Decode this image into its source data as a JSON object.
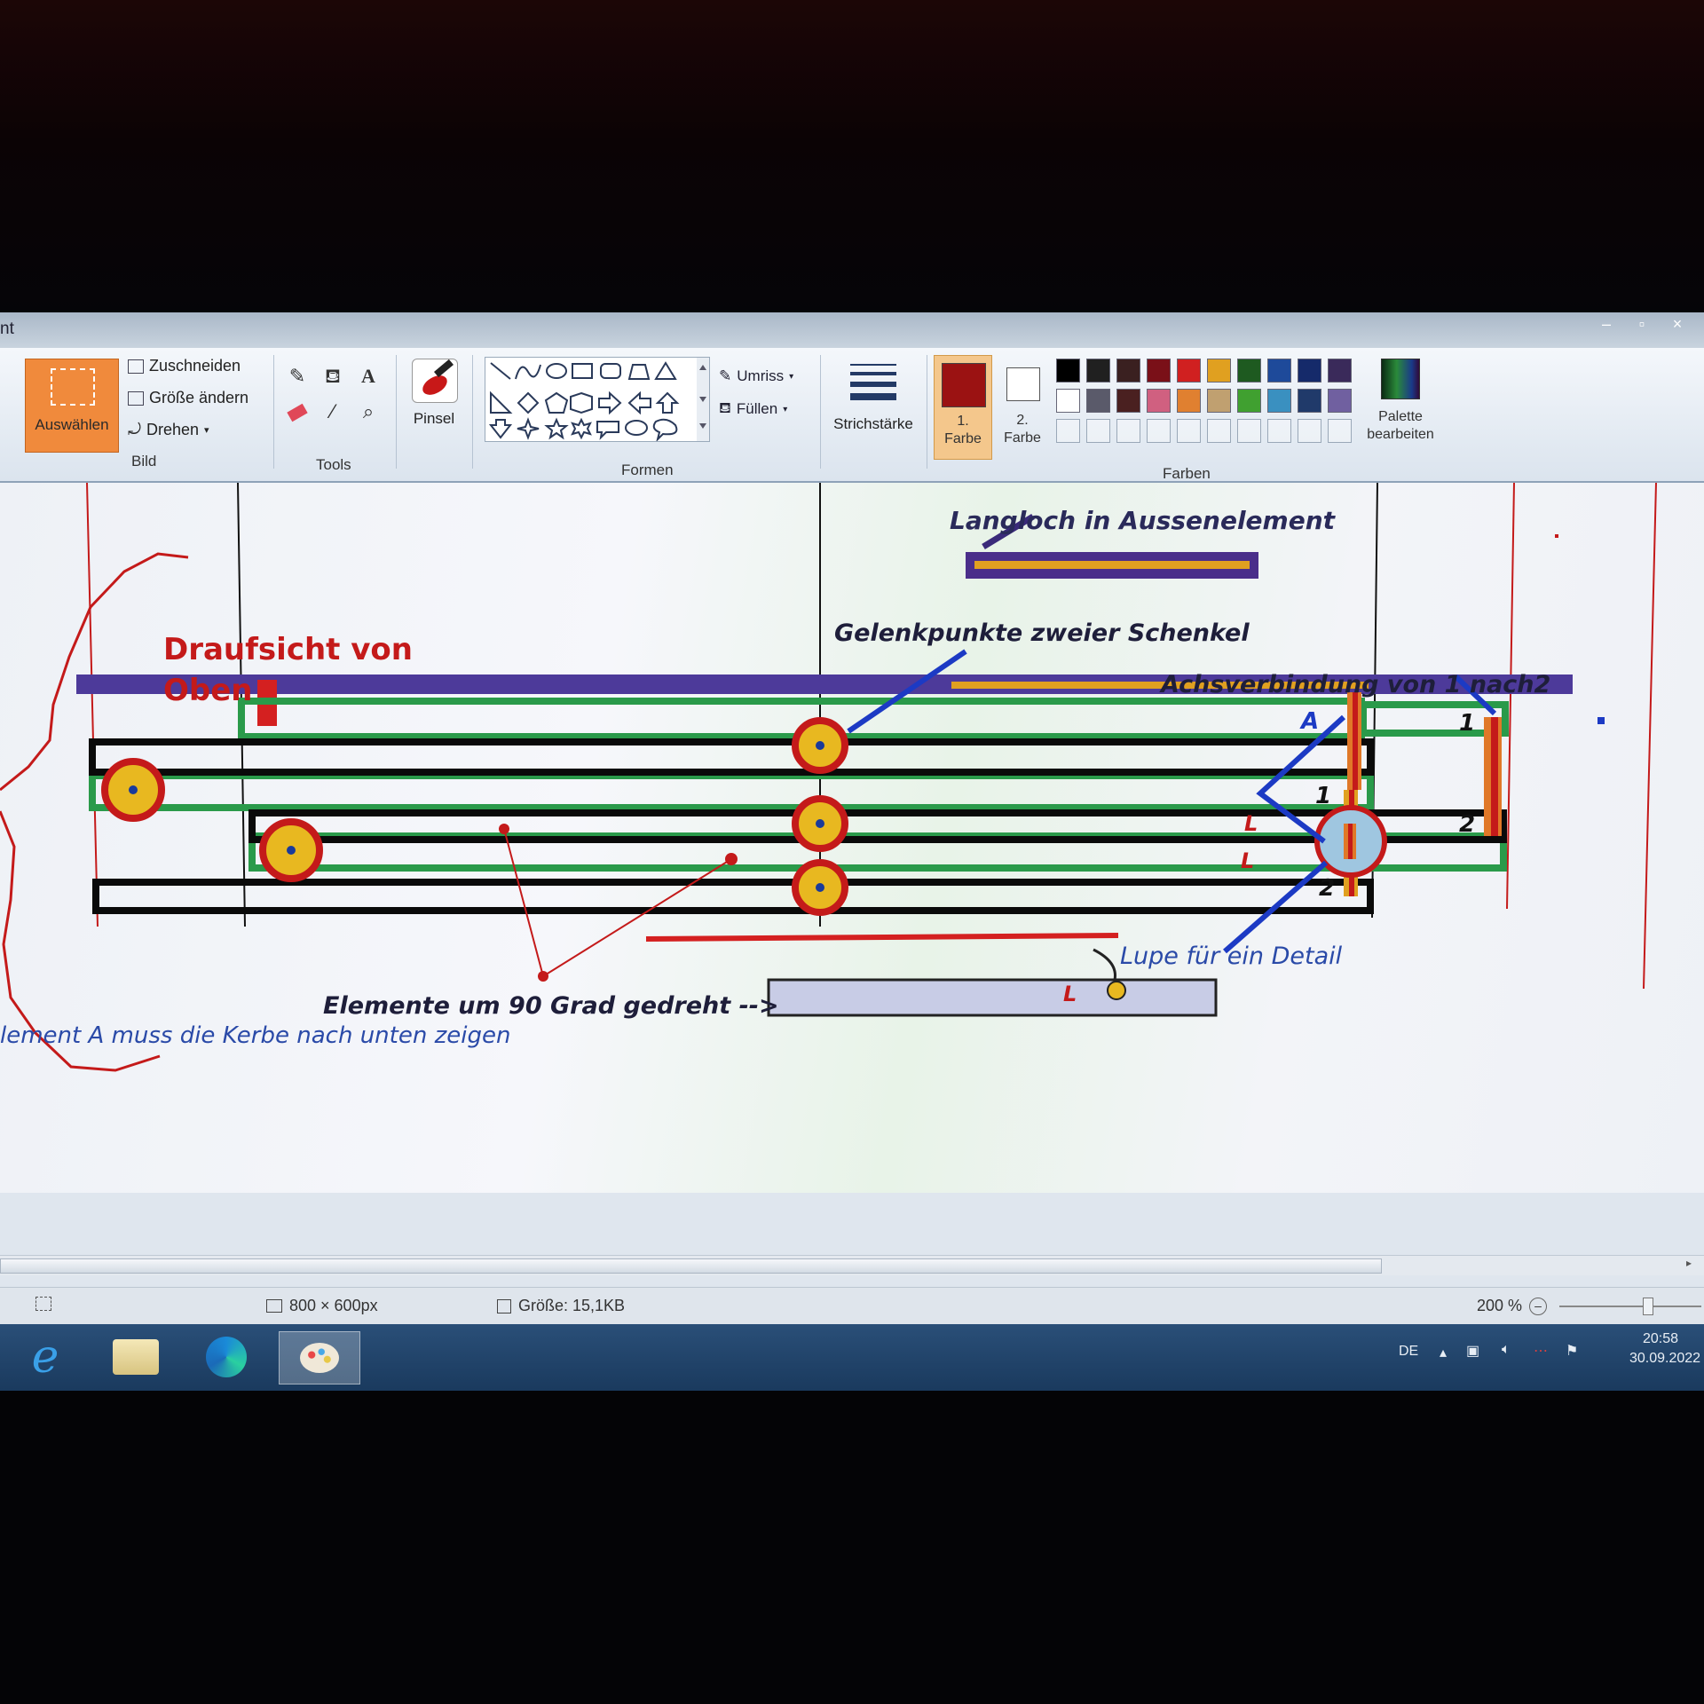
{
  "window": {
    "title_fragment": "nt",
    "controls": [
      "–",
      "▫",
      "×"
    ]
  },
  "ribbon": {
    "bild": {
      "group_label": "Bild",
      "select_label": "Auswählen",
      "crop_label": "Zuschneiden",
      "resize_label": "Größe ändern",
      "rotate_label": "Drehen"
    },
    "tools": {
      "group_label": "Tools",
      "icons": [
        "pencil-icon",
        "fill-bucket-icon",
        "text-icon",
        "eraser-icon",
        "color-picker-icon",
        "magnifier-icon"
      ]
    },
    "brush_label": "Pinsel",
    "shapes": {
      "group_label": "Formen",
      "outline_label": "Umriss",
      "fill_label": "Füllen"
    },
    "stroke_label": "Strichstärke",
    "colors": {
      "group_label": "Farben",
      "color1_label_a": "1.",
      "color1_label_b": "Farbe",
      "color2_label_a": "2.",
      "color2_label_b": "Farbe",
      "color1": "#9b1212",
      "color2": "#ffffff",
      "palette_row1": [
        "#000000",
        "#202020",
        "#3a2020",
        "#7a1018",
        "#d02020",
        "#e0a020",
        "#1e5a20",
        "#1e4a9a",
        "#152a6a",
        "#3a2a5a"
      ],
      "palette_row2": [
        "#ffffff",
        "#5a5a6a",
        "#4a2020",
        "#d06080",
        "#e08030",
        "#c0a070",
        "#40a030",
        "#3a90c0",
        "#203a6a",
        "#7060a0"
      ],
      "edit_label_a": "Palette",
      "edit_label_b": "bearbeiten"
    }
  },
  "canvas": {
    "annotations": {
      "langloch": "Langloch in Aussenelement",
      "draufsicht_line1": "Draufsicht von",
      "draufsicht_line2": "Oben",
      "gelenk": "Gelenkpunkte zweier Schenkel",
      "achs": "Achsverbindung von 1 nach2",
      "lupe": "Lupe für ein Detail",
      "elemente": "Elemente um 90 Grad gedreht -->",
      "element_a": "lement A muss die Kerbe nach unten zeigen"
    },
    "labels": {
      "A": "A",
      "one_a": "1",
      "one_b": "1",
      "two_a": "2",
      "two_b": "2",
      "L1": "L",
      "L2": "L",
      "L3": "L"
    }
  },
  "statusbar": {
    "dimensions": "800 × 600px",
    "size": "Größe: 15,1KB",
    "zoom": "200 %"
  },
  "taskbar": {
    "lang": "DE",
    "time": "20:58",
    "date": "30.09.2022"
  }
}
